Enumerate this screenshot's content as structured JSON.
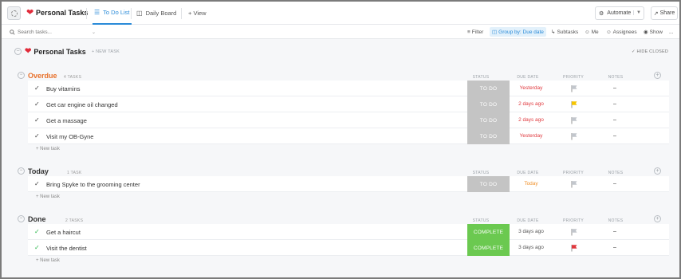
{
  "app": {
    "title": "Personal Tasks",
    "views": [
      {
        "label": "To Do List",
        "active": true
      },
      {
        "label": "Daily Board",
        "active": false
      },
      {
        "label": "+ View",
        "active": false
      }
    ],
    "automate_label": "Automate",
    "share_label": "Share"
  },
  "toolbar": {
    "search_placeholder": "Search tasks...",
    "filter": "Filter",
    "group_by": "Group by: Due date",
    "subtasks": "Subtasks",
    "me": "Me",
    "assignees": "Assignees",
    "show": "Show",
    "more": "..."
  },
  "list": {
    "title": "Personal Tasks",
    "new_task": "+ NEW TASK",
    "hide_closed": "HIDE CLOSED",
    "columns": {
      "status": "STATUS",
      "due": "DUE DATE",
      "priority": "PRIORITY",
      "notes": "NOTES"
    },
    "new_task_row": "+ New task"
  },
  "groups": [
    {
      "name": "Overdue",
      "count": "4 TASKS",
      "color": "#e8702a",
      "tasks": [
        {
          "name": "Buy vitamins",
          "status": "TO DO",
          "status_color": "#c4c4c4",
          "due": "Yesterday",
          "due_color": "#e0393e",
          "priority_flag": "#c2c6cc",
          "notes": "–",
          "done": false
        },
        {
          "name": "Get car engine oil changed",
          "status": "TO DO",
          "status_color": "#c4c4c4",
          "due": "2 days ago",
          "due_color": "#e0393e",
          "priority_flag": "#f5c400",
          "notes": "–",
          "done": false
        },
        {
          "name": "Get a massage",
          "status": "TO DO",
          "status_color": "#c4c4c4",
          "due": "2 days ago",
          "due_color": "#e0393e",
          "priority_flag": "#c2c6cc",
          "notes": "–",
          "done": false
        },
        {
          "name": "Visit my OB-Gyne",
          "status": "TO DO",
          "status_color": "#c4c4c4",
          "due": "Yesterday",
          "due_color": "#e0393e",
          "priority_flag": "#c2c6cc",
          "notes": "–",
          "done": false
        }
      ]
    },
    {
      "name": "Today",
      "count": "1 TASK",
      "color": "#333333",
      "tasks": [
        {
          "name": "Bring Spyke to the grooming center",
          "status": "TO DO",
          "status_color": "#c4c4c4",
          "due": "Today",
          "due_color": "#f0922d",
          "priority_flag": "#c2c6cc",
          "notes": "–",
          "done": false
        }
      ]
    },
    {
      "name": "Done",
      "count": "2 TASKS",
      "color": "#333333",
      "tasks": [
        {
          "name": "Get a haircut",
          "status": "COMPLETE",
          "status_color": "#6bc950",
          "due": "3 days ago",
          "due_color": "#555555",
          "priority_flag": "#c2c6cc",
          "notes": "–",
          "done": true
        },
        {
          "name": "Visit the dentist",
          "status": "COMPLETE",
          "status_color": "#6bc950",
          "due": "3 days ago",
          "due_color": "#555555",
          "priority_flag": "#e0393e",
          "notes": "–",
          "done": true
        }
      ]
    }
  ]
}
